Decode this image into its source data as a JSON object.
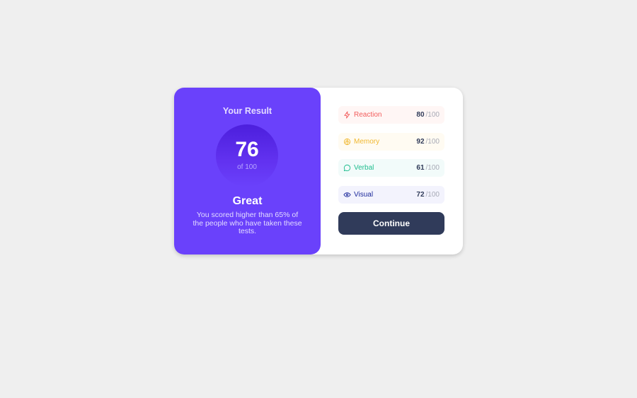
{
  "result": {
    "title": "Your Result",
    "score": "76",
    "score_of": "of 100",
    "grade": "Great",
    "description": "You scored higher than 65% of the people who have taken these tests."
  },
  "summary": {
    "items": [
      {
        "label": "Reaction",
        "value": "80",
        "max": "/100",
        "icon": "lightning-icon",
        "color": "#f25c5c",
        "bg": "#fff6f5"
      },
      {
        "label": "Memory",
        "value": "92",
        "max": "/100",
        "icon": "brain-icon",
        "color": "#f0b831",
        "bg": "#fffbf2"
      },
      {
        "label": "Verbal",
        "value": "61",
        "max": "/100",
        "icon": "chat-icon",
        "color": "#1fbd8e",
        "bg": "#f2fbfa"
      },
      {
        "label": "Visual",
        "value": "72",
        "max": "/100",
        "icon": "eye-icon",
        "color": "#1d2a9b",
        "bg": "#f3f3fd"
      }
    ],
    "continue_label": "Continue"
  }
}
